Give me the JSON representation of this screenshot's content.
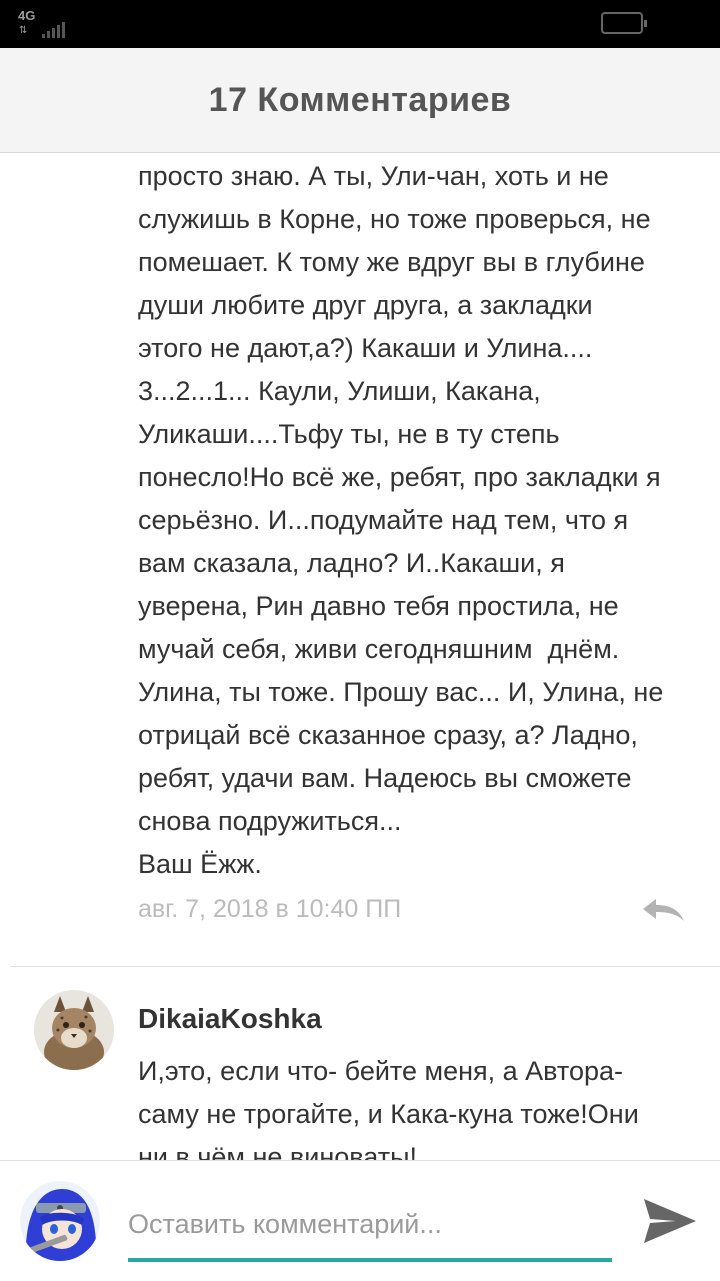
{
  "status_bar": {
    "network": "4G",
    "arrows": "⇅"
  },
  "header": {
    "title": "17 Комментариев"
  },
  "comments": [
    {
      "text": "просто знаю. А ты, Ули-чан, хоть и не\nслужишь в Корне, но тоже проверься, не\nпомешает. К тому же вдруг вы в глубине\nдуши любите друг друга, а закладки\nэтого не дают,а?) Какаши и Улина....\n3...2...1... Каули, Улиши, Какана,\nУликаши....Тьфу ты, не в ту степь\nпонесло!Но всё же, ребят, про закладки я\nсерьёзно. И...подумайте над тем, что я\nвам сказала, ладно? И..Какаши, я\nуверена, Рин давно тебя простила, не\nмучай себя, живи сегодняшним  днём.\nУлина, ты тоже. Прошу вас... И, Улина, не\nотрицай всё сказанное сразу, а? Ладно,\nребят, удачи вам. Надеюсь вы сможете\nснова подружиться...\nВаш Ёжж.",
      "date": "авг. 7, 2018 в 10:40 ПП",
      "reply_icon": "reply-icon"
    },
    {
      "author": "DikaiaKoshka",
      "text": "И,это, если что- бейте меня, а Автора-\nсаму не трогайте, и Кака-куна тоже!Они\nни в чём не виноваты!",
      "avatar": "lynx-avatar"
    }
  ],
  "composer": {
    "placeholder": "Оставить комментарий...",
    "value": "",
    "send_icon": "send-icon"
  },
  "colors": {
    "accent": "#2aa9a3",
    "header_bg": "#f4f4f4",
    "date_text": "#bbbbbb"
  }
}
